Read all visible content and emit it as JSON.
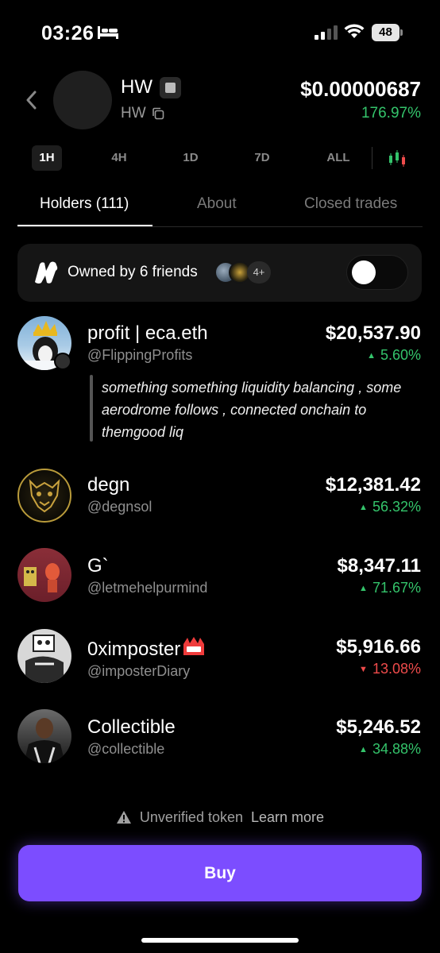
{
  "status_bar": {
    "time": "03:26",
    "battery": "48"
  },
  "token": {
    "name": "HW",
    "symbol": "HW",
    "price": "$0.00000687",
    "change": "176.97%"
  },
  "timeframes": [
    "1H",
    "4H",
    "1D",
    "7D",
    "ALL"
  ],
  "tabs": [
    "Holders (111)",
    "About",
    "Closed trades"
  ],
  "friends": {
    "text": "Owned by 6 friends",
    "extra_count": "4+"
  },
  "holders": [
    {
      "name": "profit | eca.eth",
      "handle": "@FlippingProfits",
      "value": "$20,537.90",
      "change": "5.60%",
      "direction": "up",
      "bio": "something something liquidity balancing , some aerodrome follows , connected onchain to themgood liq"
    },
    {
      "name": "degn",
      "handle": "@degnsol",
      "value": "$12,381.42",
      "change": "56.32%",
      "direction": "up"
    },
    {
      "name": "G`",
      "handle": "@letmehelpurmind",
      "value": "$8,347.11",
      "change": "71.67%",
      "direction": "up"
    },
    {
      "name": "0ximposter",
      "handle": "@imposterDiary",
      "value": "$5,916.66",
      "change": "13.08%",
      "direction": "down"
    },
    {
      "name": "Collectible",
      "handle": "@collectible",
      "value": "$5,246.52",
      "change": "34.88%",
      "direction": "up"
    }
  ],
  "footer": {
    "warning": "Unverified token",
    "learn_more": "Learn more",
    "buy": "Buy"
  },
  "colors": {
    "accent": "#7c4dff",
    "positive": "#34c46b",
    "negative": "#ef4b4b"
  }
}
